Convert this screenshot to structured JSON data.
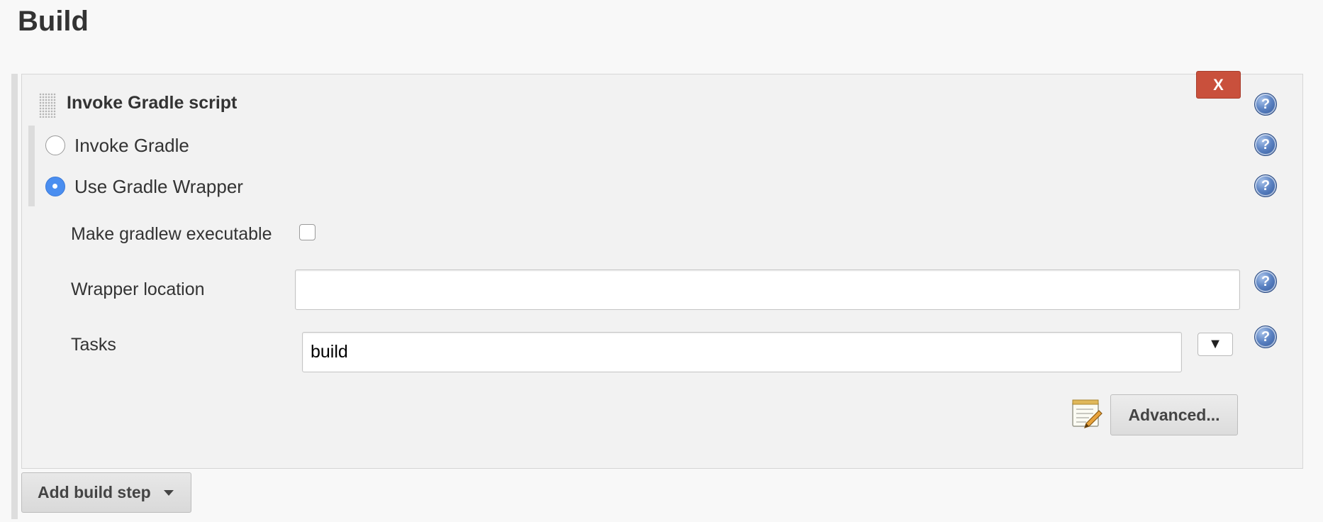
{
  "section": {
    "title": "Build"
  },
  "build_step": {
    "delete_label": "X",
    "title": "Invoke Gradle script",
    "options": [
      {
        "label": "Invoke Gradle",
        "selected": false
      },
      {
        "label": "Use Gradle Wrapper",
        "selected": true
      }
    ],
    "make_executable": {
      "label": "Make gradlew executable",
      "checked": false
    },
    "wrapper_location": {
      "label": "Wrapper location",
      "value": ""
    },
    "tasks": {
      "label": "Tasks",
      "value": "build",
      "dropdown_glyph": "▼"
    },
    "help_glyph": "?",
    "advanced_label": "Advanced..."
  },
  "add_step": {
    "label": "Add build step"
  },
  "colors": {
    "delete_button": "#c9503c",
    "radio_selected": "#4a8ef0",
    "help_icon": "#3f66a8",
    "panel_background": "#f2f2f2"
  },
  "icons": {
    "help": "help-icon",
    "notepad": "notepad-icon",
    "drag": "drag-handle-icon",
    "caret": "caret-down-icon"
  }
}
